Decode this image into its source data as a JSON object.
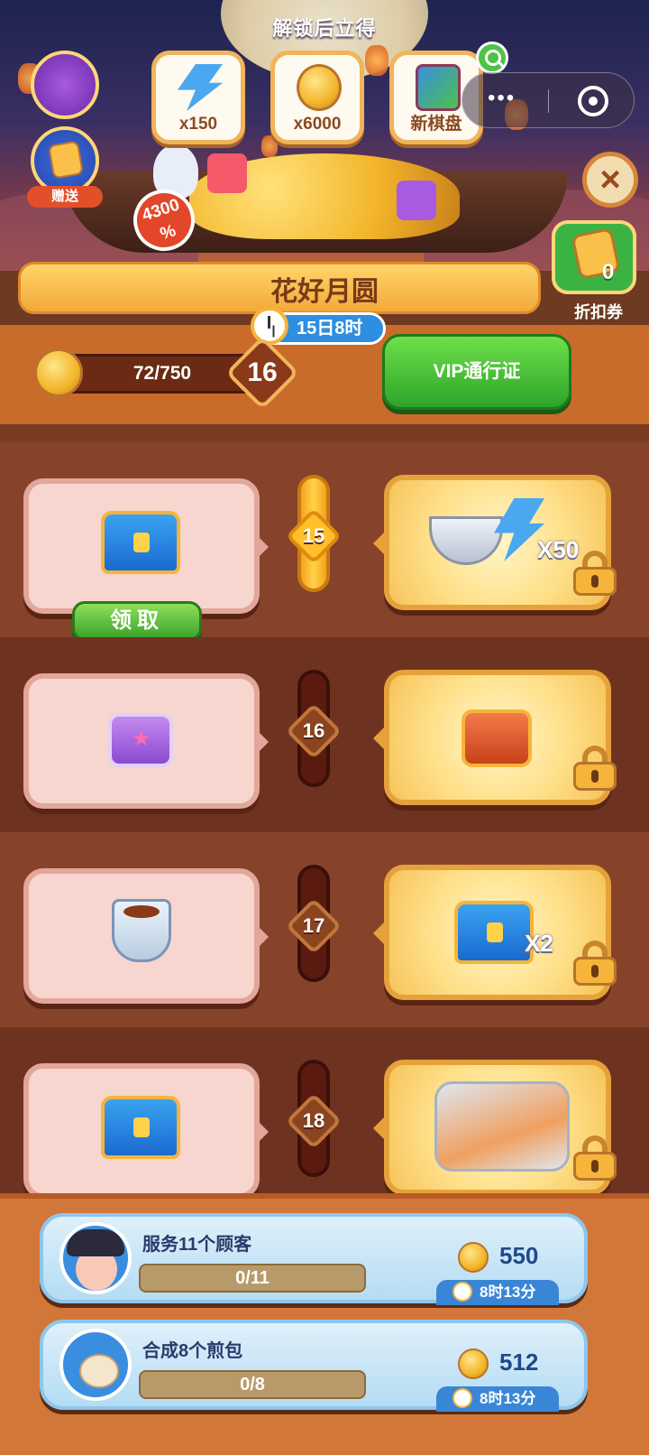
{
  "header": {
    "unlock_title": "解锁后立得",
    "rewards": [
      {
        "label": "x150",
        "icon": "lightning-icon"
      },
      {
        "label": "x6000",
        "icon": "mooncake-coin-icon"
      },
      {
        "label": "新棋盘",
        "icon": "new-board-icon"
      }
    ],
    "gift_label": "赠送",
    "bonus_percent": "4300",
    "bonus_percent_suffix": "%",
    "coupon_count": "0",
    "coupon_label": "折扣券"
  },
  "event": {
    "title": "花好月圆",
    "timer": "15日8时"
  },
  "progress": {
    "text": "72/750",
    "current": 72,
    "target": 750,
    "level": "16",
    "vip_button": "VIP通行证"
  },
  "track": [
    {
      "level": "15",
      "active": true,
      "free_item": "blue-chest-icon",
      "claim_label": "领取",
      "vip_item": "bowl-and-lightning-icon",
      "vip_qty": "X50"
    },
    {
      "level": "16",
      "active": false,
      "free_item": "purple-chest-icon",
      "vip_item": "red-chest-icon",
      "vip_qty": ""
    },
    {
      "level": "17",
      "active": false,
      "free_item": "tea-cup-icon",
      "vip_item": "blue-chest-icon",
      "vip_qty": "X2"
    },
    {
      "level": "18",
      "active": false,
      "free_item": "blue-chest-icon",
      "vip_item": "food-platter-icon",
      "vip_qty": ""
    }
  ],
  "tasks": [
    {
      "title": "服务11个顾客",
      "progress": "0/11",
      "reward": "550",
      "timer": "8时13分"
    },
    {
      "title": "合成8个煎包",
      "progress": "0/8",
      "reward": "512",
      "timer": "8时13分"
    }
  ],
  "colors": {
    "vip_green": "#3aa32a",
    "track_brown": "#7a3a22",
    "gold": "#f6b43a"
  }
}
